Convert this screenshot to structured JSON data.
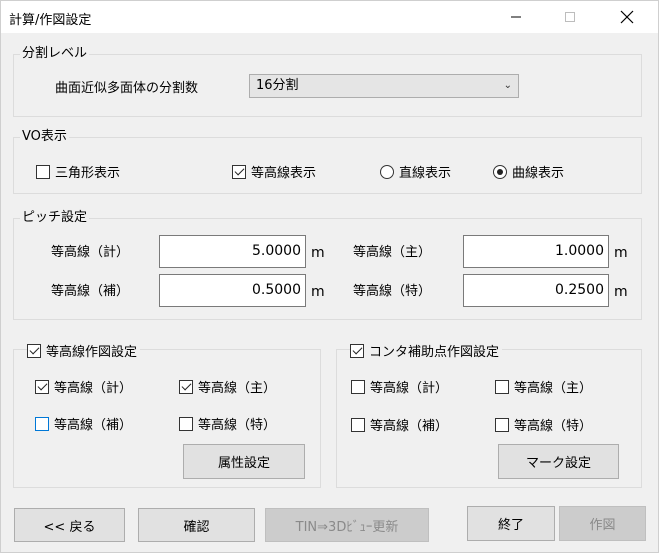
{
  "window": {
    "title": "計算/作図設定",
    "minimize_icon": "minimize-icon",
    "maximize_icon": "maximize-icon",
    "close_icon": "close-icon"
  },
  "division": {
    "group_title": "分割レベル",
    "label": "曲面近似多面体の分割数",
    "selected": "16分割"
  },
  "vo_display": {
    "group_title": "VO表示",
    "triangle": {
      "label": "三角形表示",
      "checked": false
    },
    "contour": {
      "label": "等高線表示",
      "checked": true
    },
    "straight": {
      "label": "直線表示",
      "selected": false
    },
    "curve": {
      "label": "曲線表示",
      "selected": true
    }
  },
  "pitch": {
    "group_title": "ピッチ設定",
    "unit": "m",
    "keisan": {
      "label": "等高線（計）",
      "value": "5.0000"
    },
    "main": {
      "label": "等高線（主）",
      "value": "1.0000"
    },
    "hojo": {
      "label": "等高線（補）",
      "value": "0.5000"
    },
    "toku": {
      "label": "等高線（特）",
      "value": "0.2500"
    }
  },
  "contour_drawing": {
    "group_title": "等高線作図設定",
    "enabled": true,
    "keisan": {
      "label": "等高線（計）",
      "checked": true
    },
    "main": {
      "label": "等高線（主）",
      "checked": true
    },
    "hojo": {
      "label": "等高線（補）",
      "checked": false
    },
    "toku": {
      "label": "等高線（特）",
      "checked": false
    },
    "attr_button": "属性設定"
  },
  "contour_aux": {
    "group_title": "コンタ補助点作図設定",
    "enabled": true,
    "keisan": {
      "label": "等高線（計）",
      "checked": false
    },
    "main": {
      "label": "等高線（主）",
      "checked": false
    },
    "hojo": {
      "label": "等高線（補）",
      "checked": false
    },
    "toku": {
      "label": "等高線（特）",
      "checked": false
    },
    "mark_button": "マーク設定"
  },
  "footer": {
    "back": "<< 戻る",
    "confirm": "確認",
    "tin_update": "TIN⇒3Dﾋﾞｭｰ更新",
    "finish": "終了",
    "draw": "作図"
  },
  "colors": {
    "focus_border": "#0078d7",
    "disabled_text": "#8a8a8a"
  }
}
